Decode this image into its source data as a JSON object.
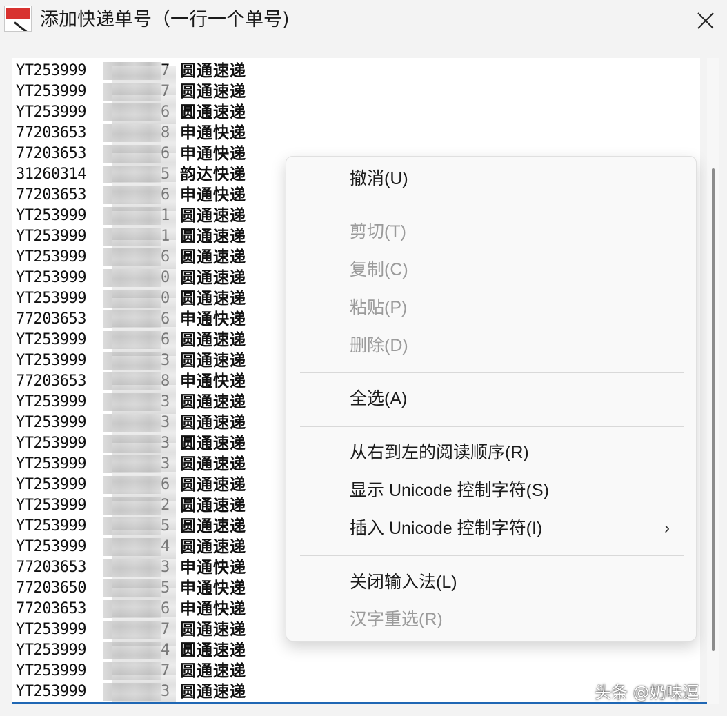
{
  "window": {
    "title": "添加快递单号（一行一个单号)",
    "icon_name": "app-logo-icon",
    "close_icon": "close-icon"
  },
  "textarea": {
    "lines": [
      {
        "prefix": "YT253999",
        "suffix": "7",
        "carrier": "圆通速递"
      },
      {
        "prefix": "YT253999",
        "suffix": "7",
        "carrier": "圆通速递"
      },
      {
        "prefix": "YT253999",
        "suffix": "6",
        "carrier": "圆通速递"
      },
      {
        "prefix": "77203653",
        "suffix": "8",
        "carrier": "申通快递"
      },
      {
        "prefix": "77203653",
        "suffix": "6",
        "carrier": "申通快递"
      },
      {
        "prefix": "31260314",
        "suffix": "5",
        "carrier": "韵达快递"
      },
      {
        "prefix": "77203653",
        "suffix": "6",
        "carrier": "申通快递"
      },
      {
        "prefix": "YT253999",
        "suffix": "1",
        "carrier": "圆通速递"
      },
      {
        "prefix": "YT253999",
        "suffix": "1",
        "carrier": "圆通速递"
      },
      {
        "prefix": "YT253999",
        "suffix": "6",
        "carrier": "圆通速递"
      },
      {
        "prefix": "YT253999",
        "suffix": "0",
        "carrier": "圆通速递"
      },
      {
        "prefix": "YT253999",
        "suffix": "0",
        "carrier": "圆通速递"
      },
      {
        "prefix": "77203653",
        "suffix": "6",
        "carrier": "申通快递"
      },
      {
        "prefix": "YT253999",
        "suffix": "6",
        "carrier": "圆通速递"
      },
      {
        "prefix": "YT253999",
        "suffix": "3",
        "carrier": "圆通速递"
      },
      {
        "prefix": "77203653",
        "suffix": "8",
        "carrier": "申通快递"
      },
      {
        "prefix": "YT253999",
        "suffix": "3",
        "carrier": "圆通速递"
      },
      {
        "prefix": "YT253999",
        "suffix": "3",
        "carrier": "圆通速递"
      },
      {
        "prefix": "YT253999",
        "suffix": "3",
        "carrier": "圆通速递"
      },
      {
        "prefix": "YT253999",
        "suffix": "3",
        "carrier": "圆通速递"
      },
      {
        "prefix": "YT253999",
        "suffix": "6",
        "carrier": "圆通速递"
      },
      {
        "prefix": "YT253999",
        "suffix": "2",
        "carrier": "圆通速递"
      },
      {
        "prefix": "YT253999",
        "suffix": "5",
        "carrier": "圆通速递"
      },
      {
        "prefix": "YT253999",
        "suffix": "4",
        "carrier": "圆通速递"
      },
      {
        "prefix": "77203653",
        "suffix": "3",
        "carrier": "申通快递"
      },
      {
        "prefix": "77203650",
        "suffix": "5",
        "carrier": "申通快递"
      },
      {
        "prefix": "77203653",
        "suffix": "6",
        "carrier": "申通快递"
      },
      {
        "prefix": "YT253999",
        "suffix": "7",
        "carrier": "圆通速递"
      },
      {
        "prefix": "YT253999",
        "suffix": "4",
        "carrier": "圆通速递"
      },
      {
        "prefix": "YT253999",
        "suffix": "7",
        "carrier": "圆通速递"
      },
      {
        "prefix": "YT253999",
        "suffix": "3",
        "carrier": "圆通速递"
      }
    ]
  },
  "context_menu": {
    "undo": "撤消(U)",
    "cut": "剪切(T)",
    "copy": "复制(C)",
    "paste": "粘贴(P)",
    "delete": "删除(D)",
    "select_all": "全选(A)",
    "rtl_reading": "从右到左的阅读顺序(R)",
    "show_unicode": "显示 Unicode 控制字符(S)",
    "insert_unicode": "插入 Unicode 控制字符(I)",
    "submenu_arrow": "›",
    "close_ime": "关闭输入法(L)",
    "reconvert": "汉字重选(R)"
  },
  "watermark": {
    "text": "头条 @奶味逗"
  },
  "colors": {
    "accent": "#1f67b4",
    "disabled_text": "#9b9b9b"
  }
}
